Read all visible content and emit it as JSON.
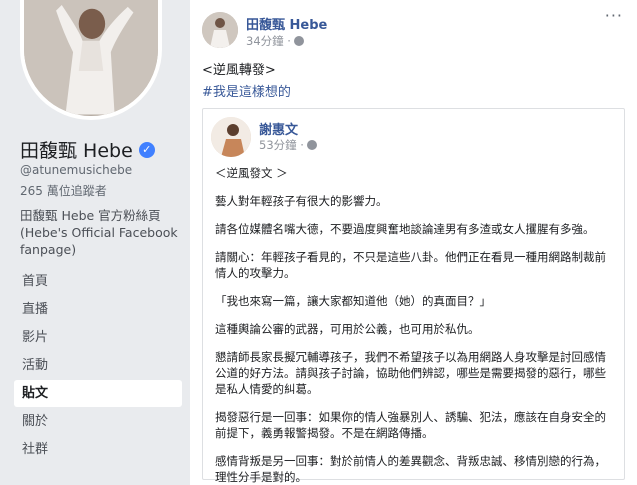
{
  "sidebar": {
    "page_name": "田馥甄 Hebe",
    "handle": "@atunemusichebe",
    "followers": "265 萬位追蹤者",
    "description": "田馥甄 Hebe 官方粉絲頁 (Hebe's Official Facebook fanpage)",
    "nav": [
      {
        "label": "首頁"
      },
      {
        "label": "直播"
      },
      {
        "label": "影片"
      },
      {
        "label": "活動"
      },
      {
        "label": "貼文",
        "active": true
      },
      {
        "label": "關於"
      },
      {
        "label": "社群"
      }
    ]
  },
  "post": {
    "author": "田馥甄 Hebe",
    "time": "34分鐘 ·",
    "line1": "<逆風轉發>",
    "hashtag": "#我是這樣想的",
    "more": "···"
  },
  "shared": {
    "author": "謝惠文",
    "time": "53分鐘 ·",
    "paragraphs": [
      "＜逆風發文 ＞",
      "藝人對年輕孩子有很大的影響力。",
      "請各位媒體名嘴大德，不要過度興奮地談論達男有多渣或女人攫腥有多強。",
      "請關心：年輕孩子看見的，不只是這些八卦。他們正在看見一種用網路制裁前情人的攻擊力。",
      "「我也來寫一篇，讓大家都知道他（她）的真面目？」",
      "這種輿論公審的武器，可用於公義，也可用於私仇。",
      "懇請師長家長擬冗輔導孩子，我們不希望孩子以為用網路人身攻擊是討回感情公道的好方法。請與孩子討論，協助他們辨認，哪些是需要揭發的惡行，哪些是私人情愛的糾葛。",
      "揭發惡行是一回事：如果你的情人強暴別人、誘騙、犯法，應該在自身安全的前提下，義勇報警揭發。不是在網路傳播。",
      "感情背叛是另一回事：對於前情人的差異觀念、背叛忠誠、移情別戀的行為，理性分手是對的。"
    ]
  },
  "colors": {
    "link": "#385898",
    "sidebar_bg": "#e9ebee",
    "verified": "#4080ff"
  }
}
